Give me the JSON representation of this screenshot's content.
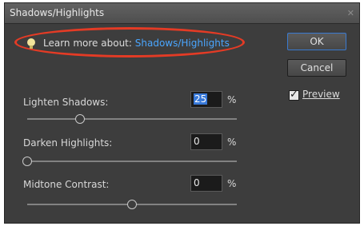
{
  "dialog": {
    "title": "Shadows/Highlights",
    "close_icon": "close-icon"
  },
  "learn_more": {
    "prefix": "Learn more about:",
    "link": "Shadows/Highlights",
    "icon": "lightbulb-icon",
    "highlight_color": "#e43b25",
    "link_color": "#4aa6ff"
  },
  "buttons": {
    "ok_label": "OK",
    "cancel_label": "Cancel"
  },
  "preview": {
    "label": "Preview",
    "checked": true
  },
  "sliders": [
    {
      "label": "Lighten Shadows:",
      "value": "25",
      "unit": "%",
      "level": 25
    },
    {
      "label": "Darken Highlights:",
      "value": "0",
      "unit": "%",
      "level": 0
    },
    {
      "label": "Midtone Contrast:",
      "value": "0",
      "unit": "%",
      "level": 50
    }
  ]
}
